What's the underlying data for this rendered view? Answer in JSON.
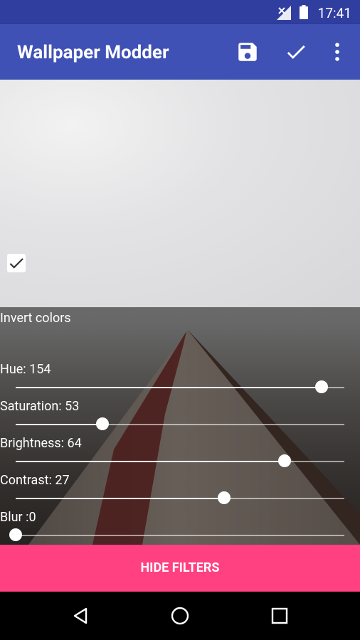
{
  "status": {
    "time": "17:41",
    "signal_icon": "signal-off-icon",
    "battery_icon": "battery-icon"
  },
  "appbar": {
    "title": "Wallpaper Modder",
    "save_icon": "save-icon",
    "apply_icon": "check-icon",
    "menu_icon": "more-vert-icon"
  },
  "filters": {
    "invert_label": "Invert colors",
    "invert_checked": true,
    "hue": {
      "label": "Hue: 154",
      "value_fraction": 0.93
    },
    "saturation": {
      "label": "Saturation: 53",
      "value_fraction": 0.265
    },
    "brightness": {
      "label": "Brightness: 64",
      "value_fraction": 0.818
    },
    "contrast": {
      "label": "Contrast: 27",
      "value_fraction": 0.634
    },
    "blur": {
      "label": "Blur :0",
      "value_fraction": 0.0
    }
  },
  "button": {
    "hide_label": "HIDE FILTERS"
  },
  "nav": {
    "back_icon": "back-icon",
    "home_icon": "home-icon",
    "recents_icon": "recents-icon"
  },
  "colors": {
    "primary": "#3f51b5",
    "primary_dark": "#303f9f",
    "accent": "#ff4081"
  }
}
